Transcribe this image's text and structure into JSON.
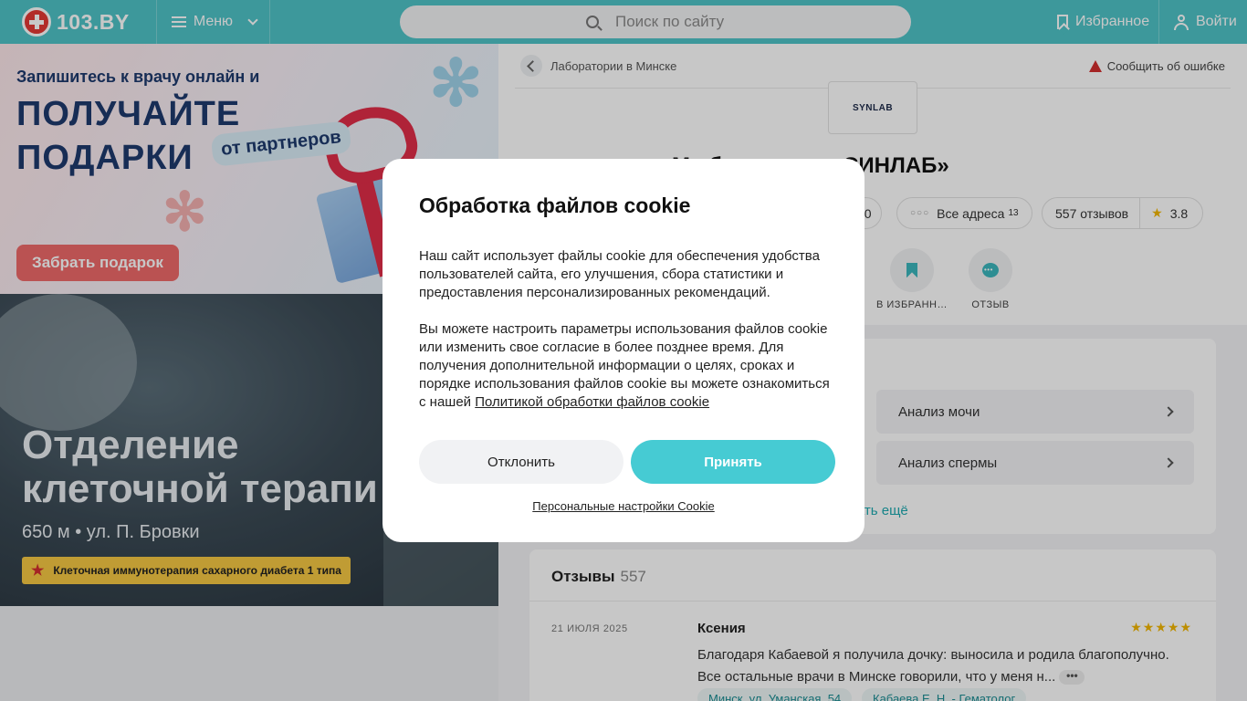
{
  "header": {
    "logo_text": "103.BY",
    "menu_label": "Меню",
    "search_placeholder": "Поиск по сайту",
    "favorites_label": "Избранное",
    "login_label": "Войти",
    "brand_color": "#4fc3c7"
  },
  "promo": {
    "line1": "Запишитесь к врачу онлайн и",
    "big1": "ПОЛУЧАЙТЕ",
    "big2": "ПОДАРКИ",
    "pill": "от партнеров",
    "button": "Забрать подарок"
  },
  "feature": {
    "title_line1": "Отделение",
    "title_line2": "клеточной терапи",
    "subtitle": "650 м • ул. П. Бровки",
    "badge": "Клеточная иммунотерапия сахарного диабета 1 типа"
  },
  "page": {
    "breadcrumb": "Лаборатории в Минске",
    "report_error": "Сообщить об ошибке",
    "logo_text": "SYNLAB",
    "title": "М           аборатория «СИНЛАБ»",
    "pills": {
      "partial": "00",
      "addresses": "Все адреса",
      "addresses_count": "13",
      "reviews": "557 отзывов",
      "rating": "3.8"
    },
    "actions": {
      "favorite": "В ИЗБРАНН…",
      "review": "ОТЗЫВ"
    }
  },
  "analyses": {
    "items": [
      "Анализ мочи",
      "Анализ спермы"
    ],
    "show_more": "зать ещё"
  },
  "reviews": {
    "title": "Отзывы",
    "count": "557",
    "items": [
      {
        "date": "21 ИЮЛЯ 2025",
        "author": "Ксения",
        "stars": "★★★★★",
        "text": "Благодаря Кабаевой я получила дочку: выносила и родила благополучно. Все остальные врачи в Минске говорили, что у меня н...",
        "more": "•••",
        "tags": [
          "Минск, ул. Уманская, 54",
          "Кабаева Е. Н. - Гематолог"
        ]
      }
    ]
  },
  "cookie": {
    "title": "Обработка файлов cookie",
    "paragraph1": "Наш сайт использует файлы cookie для обеспечения удобства пользователей сайта, его улучшения, сбора статистики и предоставления персонализированных рекомендаций.",
    "paragraph2": "Вы можете настроить параметры использования файлов cookie или изменить свое согласие в более позднее время. Для получения дополнительной информации о целях, сроках и порядке использования файлов cookie вы можете ознакомиться с нашей",
    "policy_link": "Политикой обработки файлов cookie",
    "decline": "Отклонить",
    "accept": "Принять",
    "settings": "Персональные настройки Cookie",
    "accent_color": "#46cbd3"
  }
}
